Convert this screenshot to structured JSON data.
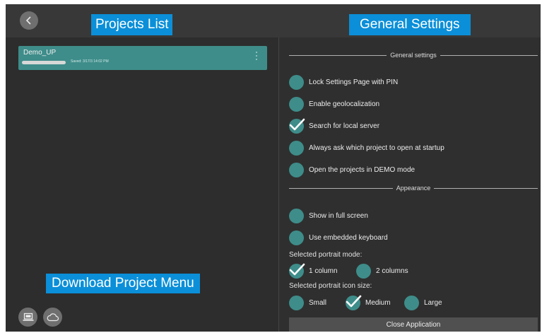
{
  "header": {
    "back_icon": "chevron-left-icon",
    "left_title": "Projects List",
    "right_title": "General Settings"
  },
  "projects": {
    "items": [
      {
        "name": "Demo_UP",
        "date": "Saved: 3/17/3 14:02 PM",
        "progress": 1.0
      }
    ],
    "download_label": "Download Project Menu",
    "local_icon": "laptop-icon",
    "cloud_icon": "cloud-icon"
  },
  "settings": {
    "general_heading": "General settings",
    "general_options": [
      {
        "label": "Lock Settings Page with PIN",
        "checked": false
      },
      {
        "label": "Enable geolocalization",
        "checked": false
      },
      {
        "label": "Search for local server",
        "checked": true
      },
      {
        "label": "Always ask which project to open at startup",
        "checked": false
      },
      {
        "label": "Open the projects in DEMO mode",
        "checked": false
      }
    ],
    "appearance_heading": "Appearance",
    "appearance_options": [
      {
        "label": "Show in full screen",
        "checked": false
      },
      {
        "label": "Use embedded keyboard",
        "checked": false
      }
    ],
    "portrait_mode_label": "Selected portrait mode:",
    "portrait_modes": [
      {
        "label": "1 column",
        "checked": true
      },
      {
        "label": "2 columns",
        "checked": false
      }
    ],
    "icon_size_label": "Selected portrait icon size:",
    "icon_sizes": [
      {
        "label": "Small",
        "checked": false
      },
      {
        "label": "Medium",
        "checked": true
      },
      {
        "label": "Large",
        "checked": false
      }
    ],
    "close_label": "Close Application"
  },
  "colors": {
    "accent_teal": "#3e8d8a",
    "label_blue": "#0b8fd8",
    "background": "#2f2f2f"
  }
}
